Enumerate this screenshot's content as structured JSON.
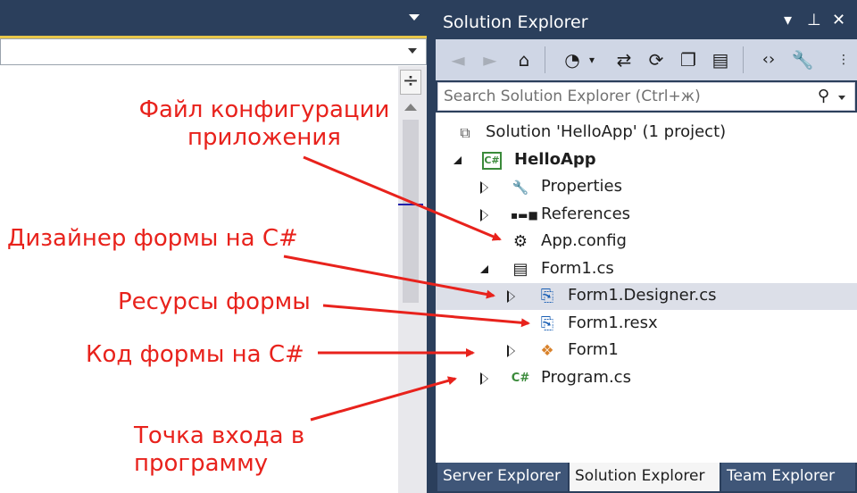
{
  "solution_explorer": {
    "title": "Solution Explorer",
    "search_placeholder": "Search Solution Explorer (Ctrl+ж)",
    "tree": [
      {
        "label": "Solution 'HelloApp' (1 project)",
        "icon": "solution-icon"
      },
      {
        "label": "HelloApp",
        "icon": "csharp-project-icon",
        "bold": true,
        "expanded": true
      },
      {
        "label": "Properties",
        "icon": "wrench-icon",
        "expanded": false
      },
      {
        "label": "References",
        "icon": "references-icon",
        "expanded": false
      },
      {
        "label": "App.config",
        "icon": "config-file-icon"
      },
      {
        "label": "Form1.cs",
        "icon": "form-icon",
        "expanded": true
      },
      {
        "label": "Form1.Designer.cs",
        "icon": "designer-file-icon",
        "expanded": false,
        "selected": true
      },
      {
        "label": "Form1.resx",
        "icon": "resx-file-icon"
      },
      {
        "label": "Form1",
        "icon": "form-class-icon",
        "expanded": false
      },
      {
        "label": "Program.cs",
        "icon": "csharp-file-icon",
        "expanded": false
      }
    ],
    "icon_text": {
      "csharp": "C#"
    },
    "tabs": [
      "Server Explorer",
      "Solution Explorer",
      "Team Explorer"
    ],
    "active_tab": "Solution Explorer"
  },
  "annotations": {
    "app_config": "Файл конфигурации\nприложения",
    "designer": "Дизайнер формы на C#",
    "resources": "Ресурсы формы",
    "code": "Код формы на C#",
    "entry_point": "Точка входа в\nпрограмму",
    "color": "#e8221c"
  },
  "colors": {
    "chrome": "#2b3f5c",
    "toolbar": "#cfd6e5",
    "selection": "#dcdfe8",
    "accent_yellow": "#e8c74a"
  }
}
